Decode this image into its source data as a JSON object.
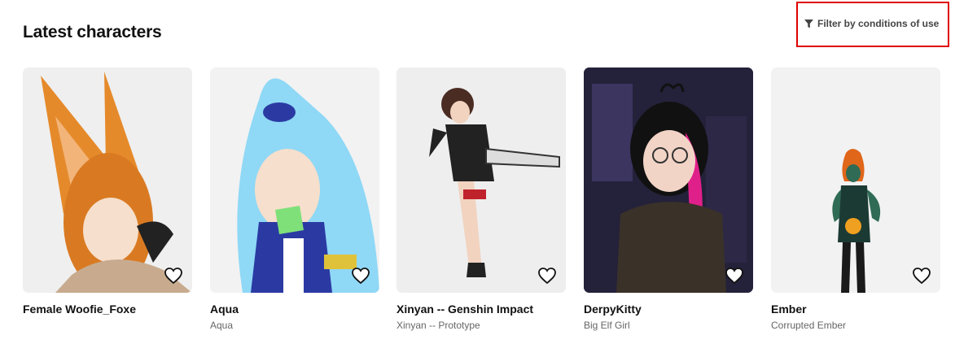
{
  "section": {
    "title": "Latest characters",
    "filter_label": "Filter by conditions of use",
    "highlight_color": "#e00000"
  },
  "cards": [
    {
      "title": "Female Woofie_Foxe",
      "subtitle": "",
      "bg": "#efefef"
    },
    {
      "title": "Aqua",
      "subtitle": "Aqua",
      "bg": "#f2f2f2"
    },
    {
      "title": "Xinyan -- Genshin Impact",
      "subtitle": "Xinyan -- Prototype",
      "bg": "#eeeeee"
    },
    {
      "title": "DerpyKitty",
      "subtitle": "Big Elf Girl",
      "bg": "#1e1c2c"
    },
    {
      "title": "Ember",
      "subtitle": "Corrupted Ember",
      "bg": "#f2f2f2"
    }
  ],
  "icons": {
    "filter": "filter-icon",
    "favorite": "heart-icon"
  }
}
